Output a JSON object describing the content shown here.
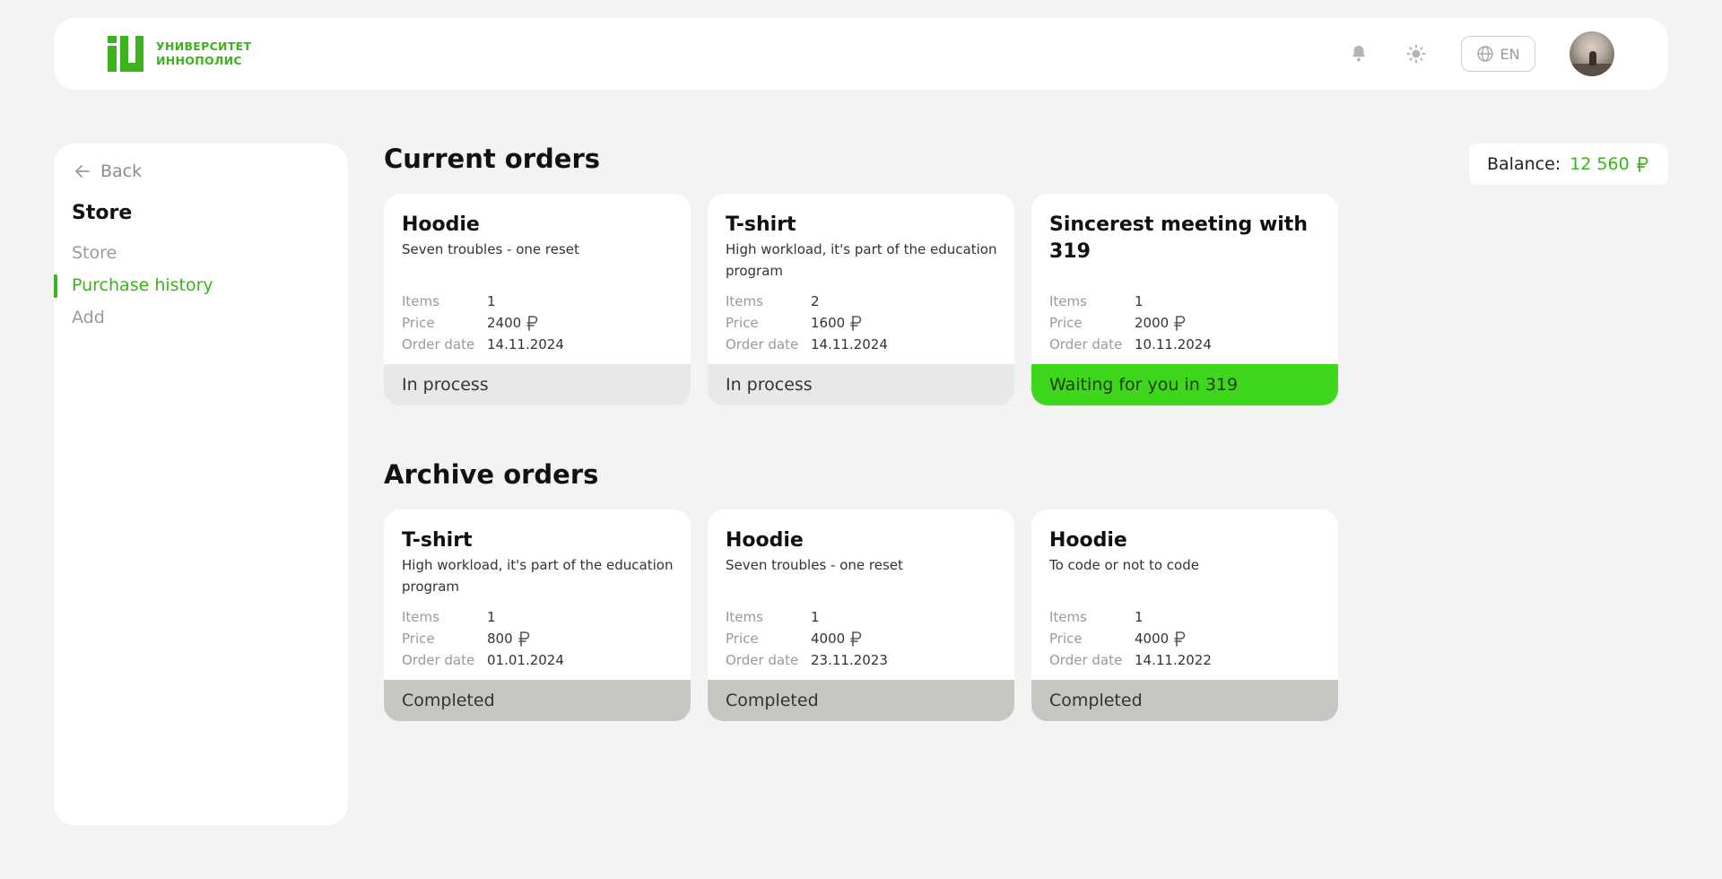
{
  "header": {
    "logo_line1": "УНИВЕРСИТЕТ",
    "logo_line2": "ИННОПОЛИС",
    "lang": "EN",
    "icons": [
      "bell-icon",
      "sun-icon",
      "globe-icon"
    ]
  },
  "sidebar": {
    "back": "Back",
    "title": "Store",
    "items": [
      {
        "label": "Store",
        "active": false
      },
      {
        "label": "Purchase history",
        "active": true
      },
      {
        "label": "Add",
        "active": false
      }
    ]
  },
  "balance": {
    "label": "Balance:",
    "amount": "12 560"
  },
  "colors": {
    "accent": "#3cb31c",
    "waiting": "#3fd71b",
    "completed": "#c7c7c2",
    "in_process": "#e8e8e8"
  },
  "meta_labels": {
    "items": "Items",
    "price": "Price",
    "order_date": "Order date"
  },
  "current": {
    "title": "Current orders",
    "orders": [
      {
        "name": "Hoodie",
        "desc": "Seven troubles - one reset",
        "items": "1",
        "price": "2400",
        "date": "14.11.2024",
        "status": "In process"
      },
      {
        "name": "T-shirt",
        "desc": "High workload, it's part of the education program",
        "items": "2",
        "price": "1600",
        "date": "14.11.2024",
        "status": "In process"
      },
      {
        "name": "Sincerest meeting with 319",
        "desc": "",
        "items": "1",
        "price": "2000",
        "date": "10.11.2024",
        "status": "Waiting for you in 319"
      }
    ]
  },
  "archive": {
    "title": "Archive orders",
    "orders": [
      {
        "name": "T-shirt",
        "desc": "High workload, it's part of the education program",
        "items": "1",
        "price": "800",
        "date": "01.01.2024",
        "status": "Completed"
      },
      {
        "name": "Hoodie",
        "desc": "Seven troubles - one reset",
        "items": "1",
        "price": "4000",
        "date": "23.11.2023",
        "status": "Completed"
      },
      {
        "name": "Hoodie",
        "desc": "To code or not to code",
        "items": "1",
        "price": "4000",
        "date": "14.11.2022",
        "status": "Completed"
      }
    ]
  }
}
